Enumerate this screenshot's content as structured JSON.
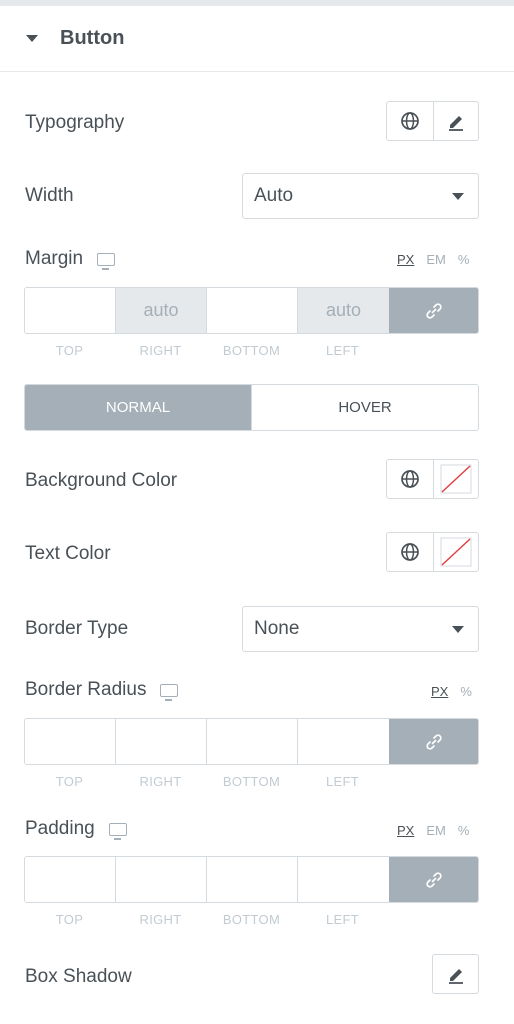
{
  "section": {
    "title": "Button"
  },
  "typography": {
    "label": "Typography"
  },
  "width": {
    "label": "Width",
    "value": "Auto"
  },
  "margin": {
    "label": "Margin",
    "units": [
      "PX",
      "EM",
      "%"
    ],
    "active_unit": "PX",
    "values": {
      "top": "",
      "right": "auto",
      "bottom": "",
      "left": "auto"
    },
    "side_labels": [
      "TOP",
      "RIGHT",
      "BOTTOM",
      "LEFT"
    ]
  },
  "state_tabs": {
    "normal": "NORMAL",
    "hover": "HOVER",
    "active": "normal"
  },
  "background_color": {
    "label": "Background Color"
  },
  "text_color": {
    "label": "Text Color"
  },
  "border_type": {
    "label": "Border Type",
    "value": "None"
  },
  "border_radius": {
    "label": "Border Radius",
    "units": [
      "PX",
      "%"
    ],
    "active_unit": "PX",
    "side_labels": [
      "TOP",
      "RIGHT",
      "BOTTOM",
      "LEFT"
    ]
  },
  "padding": {
    "label": "Padding",
    "units": [
      "PX",
      "EM",
      "%"
    ],
    "active_unit": "PX",
    "side_labels": [
      "TOP",
      "RIGHT",
      "BOTTOM",
      "LEFT"
    ]
  },
  "box_shadow": {
    "label": "Box Shadow"
  },
  "colors": {
    "text": "#495157",
    "muted": "#a4afb7",
    "border": "#d5dadf",
    "accent_gray": "#a4afb7",
    "clear_slash": "#e04040"
  },
  "icons": [
    "caret-down-icon",
    "globe-icon",
    "pencil-icon",
    "monitor-icon",
    "link-icon",
    "clear-color-icon"
  ]
}
